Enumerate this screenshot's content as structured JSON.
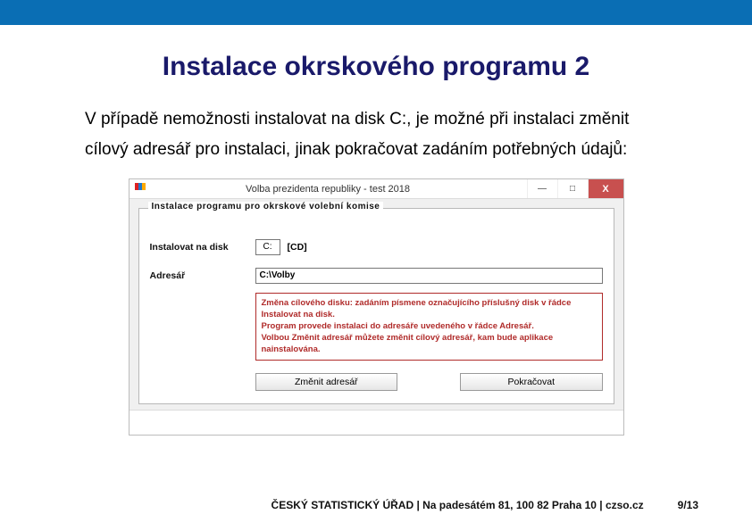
{
  "title": "Instalace okrskového programu 2",
  "paragraph": "V případě nemožnosti instalovat na disk C:, je možné při instalaci změnit cílový adresář pro instalaci, jinak pokračovat zadáním potřebných údajů:",
  "window": {
    "title": "Volba prezidenta republiky - test 2018",
    "panelLegend": "Instalace programu pro okrskové volební komise",
    "rowDisk": {
      "label": "Instalovat na disk",
      "drive": "C:",
      "driveDesc": "[CD]"
    },
    "rowDir": {
      "label": "Adresář",
      "value": "C:\\Volby"
    },
    "warning": {
      "l1": "Změna cílového disku: zadáním písmene označujícího příslušný disk v řádce Instalovat na disk.",
      "l2": "Program provede instalaci do adresáře uvedeného v řádce Adresář.",
      "l3": "Volbou Změnit adresář můžete změnit cílový adresář, kam bude aplikace nainstalována."
    },
    "buttons": {
      "change": "Změnit adresář",
      "continue": "Pokračovat"
    },
    "controls": {
      "min": "—",
      "max": "□",
      "close": "X"
    }
  },
  "footer": {
    "org": "ČESKÝ STATISTICKÝ ÚŘAD  |  Na padesátém 81, 100 82 Praha 10  |  czso.cz",
    "page": "9/13"
  }
}
